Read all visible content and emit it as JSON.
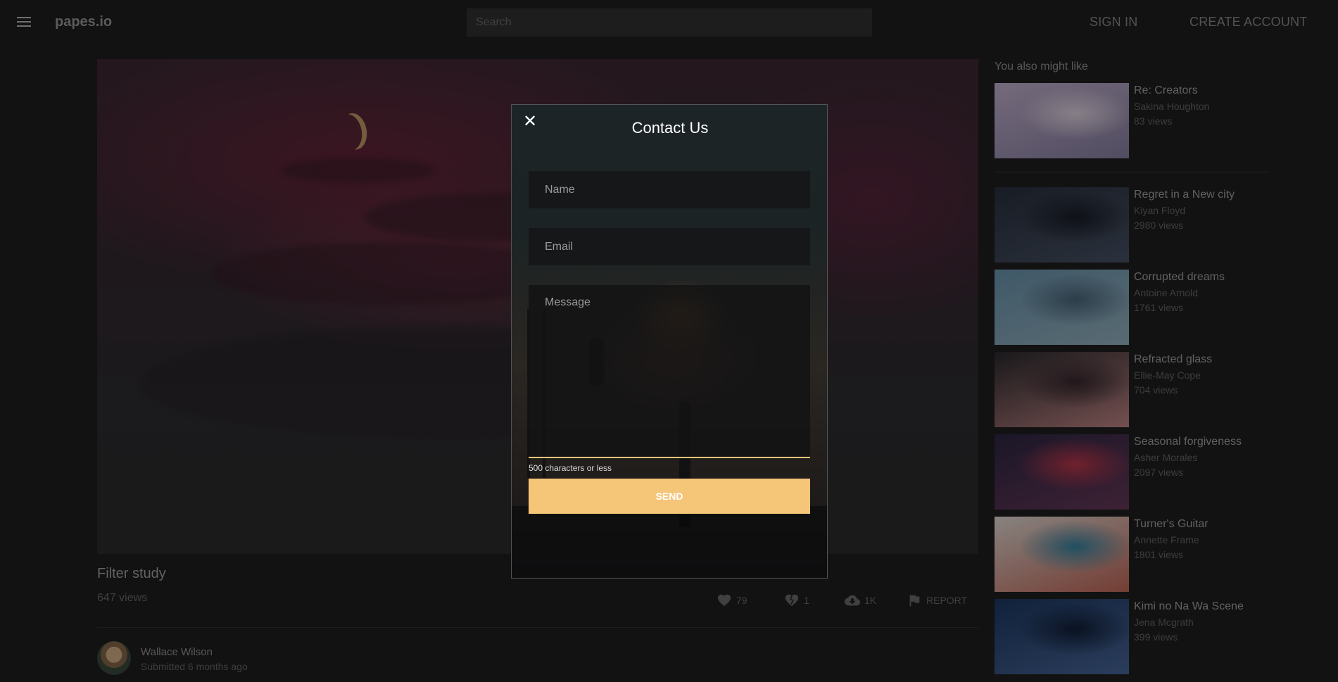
{
  "header": {
    "logo": "papes.io",
    "search_placeholder": "Search",
    "sign_in": "SIGN IN",
    "create_account": "CREATE ACCOUNT"
  },
  "wallpaper": {
    "title": "Filter study",
    "views": "647 views",
    "actions": {
      "likes": "79",
      "dislikes": "1",
      "downloads": "1K",
      "report": "REPORT"
    },
    "author": {
      "name": "Wallace Wilson",
      "submitted": "Submitted 6 months ago"
    }
  },
  "sidebar": {
    "heading": "You also might like",
    "items": [
      {
        "title": "Re: Creators",
        "author": "Sakina Houghton",
        "views": "83 views",
        "colors": [
          "#c9b8d6",
          "#8d84a8",
          "#e9dce8"
        ]
      },
      {
        "title": "Regret in a New city",
        "author": "Kiyan Floyd",
        "views": "2980 views",
        "colors": [
          "#2a3140",
          "#4a5568",
          "#1a1e28"
        ]
      },
      {
        "title": "Corrupted dreams",
        "author": "Antoine Arnold",
        "views": "1761 views",
        "colors": [
          "#6e9ab4",
          "#9ab8c6",
          "#4e6a80"
        ]
      },
      {
        "title": "Refracted glass",
        "author": "Ellie-May Cope",
        "views": "704 views",
        "colors": [
          "#2a2a2e",
          "#c98a8a",
          "#3a2a30"
        ]
      },
      {
        "title": "Seasonal forgiveness",
        "author": "Asher Morales",
        "views": "2097 views",
        "colors": [
          "#2e2846",
          "#6a3a5a",
          "#c2384e"
        ]
      },
      {
        "title": "Turner's Guitar",
        "author": "Annette Frame",
        "views": "1801 views",
        "colors": [
          "#e9e2dc",
          "#c86a5a",
          "#3a8aa8"
        ]
      },
      {
        "title": "Kimi no Na Wa Scene",
        "author": "Jena Mcgrath",
        "views": "399 views",
        "colors": [
          "#1e3a66",
          "#4a6a9e",
          "#12203a"
        ]
      }
    ]
  },
  "modal": {
    "title": "Contact Us",
    "close": "✕",
    "name_placeholder": "Name",
    "email_placeholder": "Email",
    "message_placeholder": "Message",
    "hint": "500 characters or less",
    "send": "SEND",
    "accent": "#f5c578"
  }
}
